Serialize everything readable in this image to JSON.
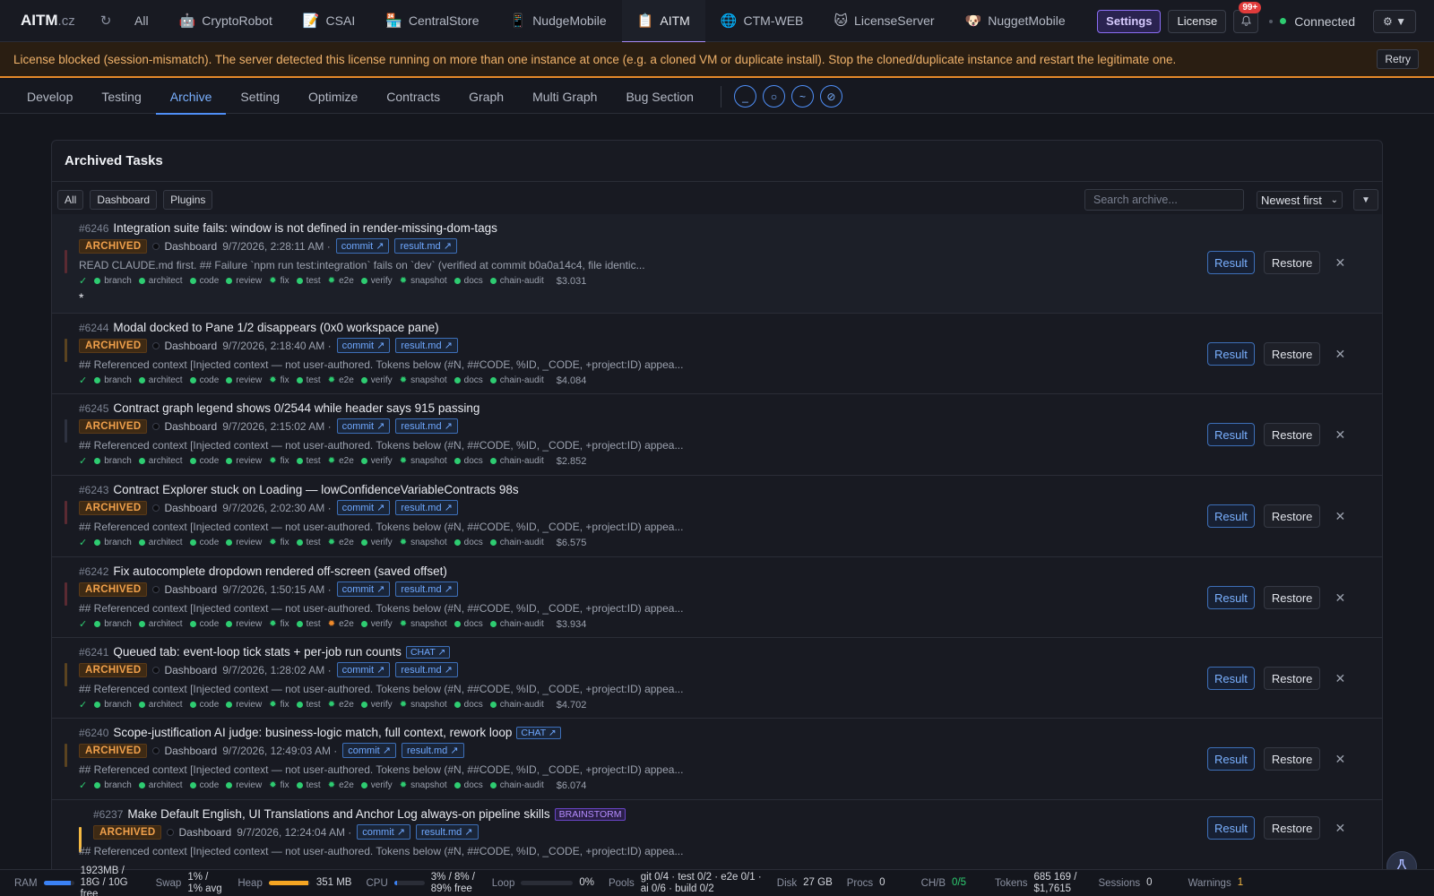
{
  "app": {
    "name": "AITM",
    "domain": ".cz"
  },
  "topbar": {
    "all_label": "All",
    "projects": [
      {
        "label": "CryptoRobot",
        "icon": "🤖"
      },
      {
        "label": "CSAI",
        "icon": "📝"
      },
      {
        "label": "CentralStore",
        "icon": "🏪"
      },
      {
        "label": "NudgeMobile",
        "icon": "📱"
      },
      {
        "label": "AITM",
        "icon": "📋",
        "active": true
      },
      {
        "label": "CTM-WEB",
        "icon": "🌐"
      },
      {
        "label": "LicenseServer",
        "icon": "🐱"
      },
      {
        "label": "NuggetMobile",
        "icon": "🐶"
      }
    ],
    "settings_label": "Settings",
    "license_label": "License",
    "notif_badge": "99+",
    "status_label": "Connected",
    "menu_label": "⚙ ▼"
  },
  "banner": {
    "message": "License blocked (session-mismatch). The server detected this license running on more than one instance at once (e.g. a cloned VM or duplicate install). Stop the cloned/duplicate instance and restart the legitimate one.",
    "retry_label": "Retry"
  },
  "subnav": {
    "tabs": [
      "Develop",
      "Testing",
      "Archive",
      "Setting",
      "Optimize",
      "Contracts",
      "Graph",
      "Multi Graph",
      "Bug Section"
    ],
    "active_tab": "Archive",
    "tool_icons": [
      "_",
      "○",
      "~",
      "⊘"
    ]
  },
  "archive": {
    "title": "Archived Tasks",
    "filters": [
      "All",
      "Dashboard",
      "Plugins"
    ],
    "search_placeholder": "Search archive...",
    "sort_value": "Newest first",
    "stages": [
      "branch",
      "architect",
      "code",
      "review",
      "fix",
      "test",
      "e2e",
      "verify",
      "snapshot",
      "docs",
      "chain-audit"
    ],
    "status_label": "ARCHIVED",
    "result_label": "Result",
    "restore_label": "Restore",
    "commit_label": "commit ↗",
    "resultmd_label": "result.md ↗",
    "tasks": [
      {
        "id": "#6246",
        "title": "Integration suite fails: window is not defined in render-missing-dom-tags",
        "project": "Dashboard",
        "time": "9/7/2026, 2:28:11 AM ·",
        "snippet": "READ CLAUDE.md first. ## Failure `npm run test:integration` fails on `dev` (verified at commit b0a0a14c4, file identic...",
        "cost": "$3.031",
        "bar": "#5a2a32",
        "extra": "*"
      },
      {
        "id": "#6244",
        "title": "Modal docked to Pane 1/2 disappears (0x0 workspace pane)",
        "project": "Dashboard",
        "time": "9/7/2026, 2:18:40 AM ·",
        "snippet": "## Referenced context [Injected context — not user-authored. Tokens below (#N, ##CODE, %ID, _CODE, +project:ID) appea...",
        "cost": "$4.084",
        "bar": "#5a4320"
      },
      {
        "id": "#6245",
        "title": "Contract graph legend shows 0/2544 while header says 915 passing",
        "project": "Dashboard",
        "time": "9/7/2026, 2:15:02 AM ·",
        "snippet": "## Referenced context [Injected context — not user-authored. Tokens below (#N, ##CODE, %ID, _CODE, +project:ID) appea...",
        "cost": "$2.852",
        "bar": "#2e3240"
      },
      {
        "id": "#6243",
        "title": "Contract Explorer stuck on Loading — lowConfidenceVariableContracts 98s",
        "project": "Dashboard",
        "time": "9/7/2026, 2:02:30 AM ·",
        "snippet": "## Referenced context [Injected context — not user-authored. Tokens below (#N, ##CODE, %ID, _CODE, +project:ID) appea...",
        "cost": "$6.575",
        "bar": "#5a2a32"
      },
      {
        "id": "#6242",
        "title": "Fix autocomplete dropdown rendered off-screen (saved offset)",
        "project": "Dashboard",
        "time": "9/7/2026, 1:50:15 AM ·",
        "snippet": "## Referenced context [Injected context — not user-authored. Tokens below (#N, ##CODE, %ID, _CODE, +project:ID) appea...",
        "cost": "$3.934",
        "bar": "#5a2a32",
        "e2e_orange": true
      },
      {
        "id": "#6241",
        "title": "Queued tab: event-loop tick stats + per-job run counts",
        "tag": "CHAT ↗",
        "tag_type": "chat",
        "project": "Dashboard",
        "time": "9/7/2026, 1:28:02 AM ·",
        "snippet": "## Referenced context [Injected context — not user-authored. Tokens below (#N, ##CODE, %ID, _CODE, +project:ID) appea...",
        "cost": "$4.702",
        "bar": "#5a4320"
      },
      {
        "id": "#6240",
        "title": "Scope-justification AI judge: business-logic match, full context, rework loop",
        "tag": "CHAT ↗",
        "tag_type": "chat",
        "project": "Dashboard",
        "time": "9/7/2026, 12:49:03 AM ·",
        "snippet": "## Referenced context [Injected context — not user-authored. Tokens below (#N, ##CODE, %ID, _CODE, +project:ID) appea...",
        "cost": "$6.074",
        "bar": "#5a4320"
      },
      {
        "id": "#6237",
        "title": "Make Default English, UI Translations and Anchor Log always-on pipeline skills",
        "tag": "BRAINSTORM",
        "tag_type": "brain",
        "project": "Dashboard",
        "time": "9/7/2026, 12:24:04 AM ·",
        "snippet": "## Referenced context [Injected context — not user-authored. Tokens below (#N, ##CODE, %ID, _CODE, +project:ID) appea...",
        "cost": "",
        "bar": "#f5b942"
      }
    ]
  },
  "statusbar": {
    "ram_label": "RAM",
    "ram_value": "1923MB / 18G / 10G free",
    "ram_fill": 0.9,
    "swap_label": "Swap",
    "swap_value": "1% / 1% avg",
    "heap_label": "Heap",
    "heap_value": "351 MB",
    "heap_fill": 0.95,
    "cpu_label": "CPU",
    "cpu_value": "3% / 8% / 89% free",
    "cpu_fill": 0.1,
    "loop_label": "Loop",
    "loop_value": "0%",
    "loop_fill": 0.0,
    "pools_label": "Pools",
    "pools_value": "git 0/4 · test 0/2 · e2e 0/1 · ai 0/6 · build 0/2",
    "disk_label": "Disk",
    "disk_value": "27 GB",
    "procs_label": "Procs",
    "procs_value": "0",
    "chb_label": "CH/B",
    "chb_value": "0/5",
    "tokens_label": "Tokens",
    "tokens_value": "685 169 / $1,7615",
    "sessions_label": "Sessions",
    "sessions_value": "0",
    "warnings_label": "Warnings",
    "warnings_value": "1"
  }
}
